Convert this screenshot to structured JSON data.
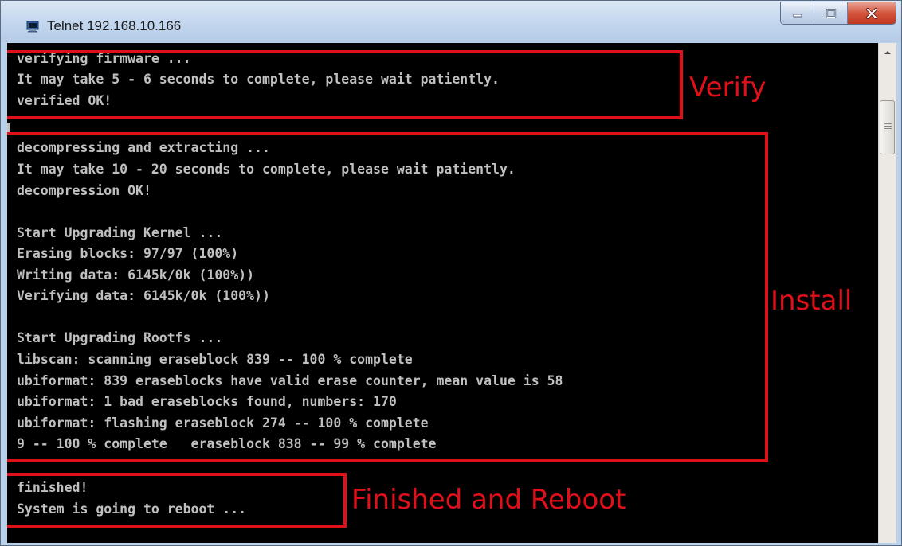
{
  "window": {
    "title": "Telnet 192.168.10.166"
  },
  "terminal": {
    "lines": [
      "verifying firmware ...",
      "It may take 5 - 6 seconds to complete, please wait patiently.",
      "verified OK!",
      "",
      "decompressing and extracting ...",
      "It may take 10 - 20 seconds to complete, please wait patiently.",
      "decompression OK!",
      "",
      "Start Upgrading Kernel ...",
      "Erasing blocks: 97/97 (100%)",
      "Writing data: 6145k/0k (100%))",
      "Verifying data: 6145k/0k (100%))",
      "",
      "Start Upgrading Rootfs ...",
      "libscan: scanning eraseblock 839 -- 100 % complete",
      "ubiformat: 839 eraseblocks have valid erase counter, mean value is 58",
      "ubiformat: 1 bad eraseblocks found, numbers: 170",
      "ubiformat: flashing eraseblock 274 -- 100 % complete",
      "9 -- 100 % complete   eraseblock 838 -- 99 % complete",
      "",
      "finished!",
      "System is going to reboot ..."
    ]
  },
  "annotations": {
    "verify": "Verify",
    "install": "Install",
    "finished": "Finished and Reboot"
  },
  "colors": {
    "terminal_bg": "#000000",
    "terminal_fg": "#c0c0c0",
    "annotation": "#e0101a"
  }
}
